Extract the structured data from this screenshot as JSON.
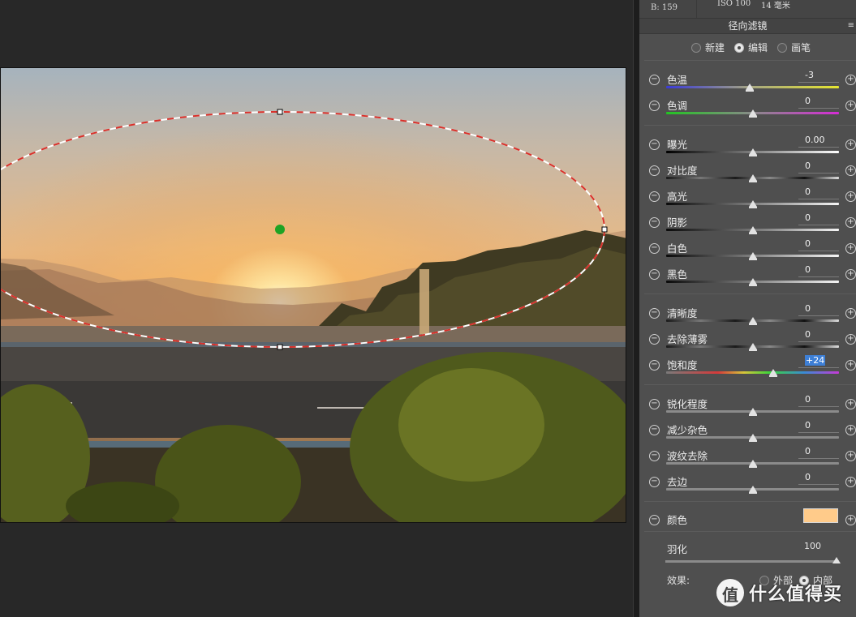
{
  "info": {
    "b_label": "B: 159",
    "iso": "ISO 100",
    "focal": "14 毫米"
  },
  "panel": {
    "title": "径向滤镜",
    "menu_icon": "≡"
  },
  "modes": [
    {
      "label": "新建",
      "selected": false
    },
    {
      "label": "编辑",
      "selected": true
    },
    {
      "label": "画笔",
      "selected": false
    }
  ],
  "sliders": {
    "temp": {
      "label": "色温",
      "value": "-3",
      "pos": 0.485
    },
    "tint": {
      "label": "色调",
      "value": "0",
      "pos": 0.5
    },
    "exposure": {
      "label": "曝光",
      "value": "0.00",
      "pos": 0.5
    },
    "contrast": {
      "label": "对比度",
      "value": "0",
      "pos": 0.5
    },
    "highlights": {
      "label": "高光",
      "value": "0",
      "pos": 0.5
    },
    "shadows": {
      "label": "阴影",
      "value": "0",
      "pos": 0.5
    },
    "whites": {
      "label": "白色",
      "value": "0",
      "pos": 0.5
    },
    "blacks": {
      "label": "黑色",
      "value": "0",
      "pos": 0.5
    },
    "clarity": {
      "label": "清晰度",
      "value": "0",
      "pos": 0.5
    },
    "dehaze": {
      "label": "去除薄雾",
      "value": "0",
      "pos": 0.5
    },
    "saturation": {
      "label": "饱和度",
      "value": "+24",
      "pos": 0.62
    },
    "sharpness": {
      "label": "锐化程度",
      "value": "0",
      "pos": 0.5
    },
    "noise": {
      "label": "减少杂色",
      "value": "0",
      "pos": 0.5
    },
    "moire": {
      "label": "波纹去除",
      "value": "0",
      "pos": 0.5
    },
    "defringe": {
      "label": "去边",
      "value": "0",
      "pos": 0.5
    }
  },
  "color": {
    "label": "颜色",
    "swatch": "#ffcb8a"
  },
  "feather": {
    "label": "羽化",
    "value": "100",
    "pos": 1.0
  },
  "effect": {
    "label": "效果:",
    "options": [
      {
        "label": "外部",
        "selected": false
      },
      {
        "label": "内部",
        "selected": true
      }
    ]
  },
  "watermark": {
    "text": "什么值得买"
  },
  "colors": {
    "mask_red": "#d9302a",
    "pin_green": "#1ea324"
  }
}
